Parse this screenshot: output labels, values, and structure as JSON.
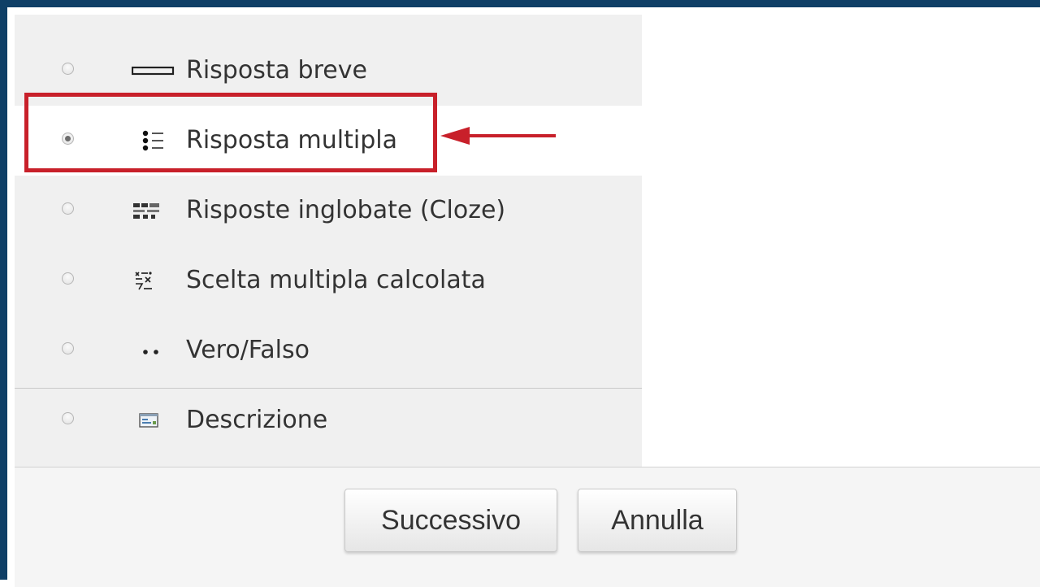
{
  "question_types": [
    {
      "label": "Risposta breve",
      "icon": "short-answer-icon",
      "selected": false
    },
    {
      "label": "Risposta multipla",
      "icon": "multiple-choice-icon",
      "selected": true
    },
    {
      "label": "Risposte inglobate (Cloze)",
      "icon": "cloze-icon",
      "selected": false
    },
    {
      "label": "Scelta multipla calcolata",
      "icon": "calculated-multichoice-icon",
      "selected": false
    },
    {
      "label": "Vero/Falso",
      "icon": "true-false-icon",
      "selected": false
    },
    {
      "label": "Descrizione",
      "icon": "description-icon",
      "selected": false
    }
  ],
  "buttons": {
    "next": "Successivo",
    "cancel": "Annulla"
  },
  "colors": {
    "frame": "#0f3f66",
    "annotation": "#c8202a",
    "panel_bg": "#f0f0f0",
    "selected_bg": "#ffffff"
  }
}
